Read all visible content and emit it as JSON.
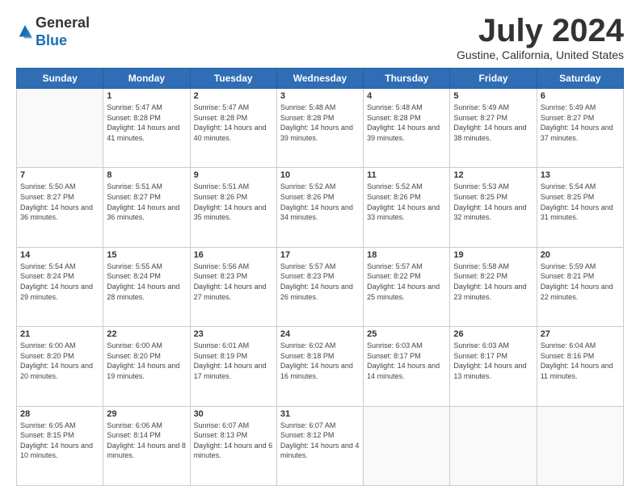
{
  "header": {
    "logo_line1": "General",
    "logo_line2": "Blue",
    "month_year": "July 2024",
    "location": "Gustine, California, United States"
  },
  "weekdays": [
    "Sunday",
    "Monday",
    "Tuesday",
    "Wednesday",
    "Thursday",
    "Friday",
    "Saturday"
  ],
  "weeks": [
    [
      {
        "day": "",
        "empty": true
      },
      {
        "day": "1",
        "sunrise": "Sunrise: 5:47 AM",
        "sunset": "Sunset: 8:28 PM",
        "daylight": "Daylight: 14 hours and 41 minutes."
      },
      {
        "day": "2",
        "sunrise": "Sunrise: 5:47 AM",
        "sunset": "Sunset: 8:28 PM",
        "daylight": "Daylight: 14 hours and 40 minutes."
      },
      {
        "day": "3",
        "sunrise": "Sunrise: 5:48 AM",
        "sunset": "Sunset: 8:28 PM",
        "daylight": "Daylight: 14 hours and 39 minutes."
      },
      {
        "day": "4",
        "sunrise": "Sunrise: 5:48 AM",
        "sunset": "Sunset: 8:28 PM",
        "daylight": "Daylight: 14 hours and 39 minutes."
      },
      {
        "day": "5",
        "sunrise": "Sunrise: 5:49 AM",
        "sunset": "Sunset: 8:27 PM",
        "daylight": "Daylight: 14 hours and 38 minutes."
      },
      {
        "day": "6",
        "sunrise": "Sunrise: 5:49 AM",
        "sunset": "Sunset: 8:27 PM",
        "daylight": "Daylight: 14 hours and 37 minutes."
      }
    ],
    [
      {
        "day": "7",
        "sunrise": "Sunrise: 5:50 AM",
        "sunset": "Sunset: 8:27 PM",
        "daylight": "Daylight: 14 hours and 36 minutes."
      },
      {
        "day": "8",
        "sunrise": "Sunrise: 5:51 AM",
        "sunset": "Sunset: 8:27 PM",
        "daylight": "Daylight: 14 hours and 36 minutes."
      },
      {
        "day": "9",
        "sunrise": "Sunrise: 5:51 AM",
        "sunset": "Sunset: 8:26 PM",
        "daylight": "Daylight: 14 hours and 35 minutes."
      },
      {
        "day": "10",
        "sunrise": "Sunrise: 5:52 AM",
        "sunset": "Sunset: 8:26 PM",
        "daylight": "Daylight: 14 hours and 34 minutes."
      },
      {
        "day": "11",
        "sunrise": "Sunrise: 5:52 AM",
        "sunset": "Sunset: 8:26 PM",
        "daylight": "Daylight: 14 hours and 33 minutes."
      },
      {
        "day": "12",
        "sunrise": "Sunrise: 5:53 AM",
        "sunset": "Sunset: 8:25 PM",
        "daylight": "Daylight: 14 hours and 32 minutes."
      },
      {
        "day": "13",
        "sunrise": "Sunrise: 5:54 AM",
        "sunset": "Sunset: 8:25 PM",
        "daylight": "Daylight: 14 hours and 31 minutes."
      }
    ],
    [
      {
        "day": "14",
        "sunrise": "Sunrise: 5:54 AM",
        "sunset": "Sunset: 8:24 PM",
        "daylight": "Daylight: 14 hours and 29 minutes."
      },
      {
        "day": "15",
        "sunrise": "Sunrise: 5:55 AM",
        "sunset": "Sunset: 8:24 PM",
        "daylight": "Daylight: 14 hours and 28 minutes."
      },
      {
        "day": "16",
        "sunrise": "Sunrise: 5:56 AM",
        "sunset": "Sunset: 8:23 PM",
        "daylight": "Daylight: 14 hours and 27 minutes."
      },
      {
        "day": "17",
        "sunrise": "Sunrise: 5:57 AM",
        "sunset": "Sunset: 8:23 PM",
        "daylight": "Daylight: 14 hours and 26 minutes."
      },
      {
        "day": "18",
        "sunrise": "Sunrise: 5:57 AM",
        "sunset": "Sunset: 8:22 PM",
        "daylight": "Daylight: 14 hours and 25 minutes."
      },
      {
        "day": "19",
        "sunrise": "Sunrise: 5:58 AM",
        "sunset": "Sunset: 8:22 PM",
        "daylight": "Daylight: 14 hours and 23 minutes."
      },
      {
        "day": "20",
        "sunrise": "Sunrise: 5:59 AM",
        "sunset": "Sunset: 8:21 PM",
        "daylight": "Daylight: 14 hours and 22 minutes."
      }
    ],
    [
      {
        "day": "21",
        "sunrise": "Sunrise: 6:00 AM",
        "sunset": "Sunset: 8:20 PM",
        "daylight": "Daylight: 14 hours and 20 minutes."
      },
      {
        "day": "22",
        "sunrise": "Sunrise: 6:00 AM",
        "sunset": "Sunset: 8:20 PM",
        "daylight": "Daylight: 14 hours and 19 minutes."
      },
      {
        "day": "23",
        "sunrise": "Sunrise: 6:01 AM",
        "sunset": "Sunset: 8:19 PM",
        "daylight": "Daylight: 14 hours and 17 minutes."
      },
      {
        "day": "24",
        "sunrise": "Sunrise: 6:02 AM",
        "sunset": "Sunset: 8:18 PM",
        "daylight": "Daylight: 14 hours and 16 minutes."
      },
      {
        "day": "25",
        "sunrise": "Sunrise: 6:03 AM",
        "sunset": "Sunset: 8:17 PM",
        "daylight": "Daylight: 14 hours and 14 minutes."
      },
      {
        "day": "26",
        "sunrise": "Sunrise: 6:03 AM",
        "sunset": "Sunset: 8:17 PM",
        "daylight": "Daylight: 14 hours and 13 minutes."
      },
      {
        "day": "27",
        "sunrise": "Sunrise: 6:04 AM",
        "sunset": "Sunset: 8:16 PM",
        "daylight": "Daylight: 14 hours and 11 minutes."
      }
    ],
    [
      {
        "day": "28",
        "sunrise": "Sunrise: 6:05 AM",
        "sunset": "Sunset: 8:15 PM",
        "daylight": "Daylight: 14 hours and 10 minutes."
      },
      {
        "day": "29",
        "sunrise": "Sunrise: 6:06 AM",
        "sunset": "Sunset: 8:14 PM",
        "daylight": "Daylight: 14 hours and 8 minutes."
      },
      {
        "day": "30",
        "sunrise": "Sunrise: 6:07 AM",
        "sunset": "Sunset: 8:13 PM",
        "daylight": "Daylight: 14 hours and 6 minutes."
      },
      {
        "day": "31",
        "sunrise": "Sunrise: 6:07 AM",
        "sunset": "Sunset: 8:12 PM",
        "daylight": "Daylight: 14 hours and 4 minutes."
      },
      {
        "day": "",
        "empty": true
      },
      {
        "day": "",
        "empty": true
      },
      {
        "day": "",
        "empty": true
      }
    ]
  ]
}
